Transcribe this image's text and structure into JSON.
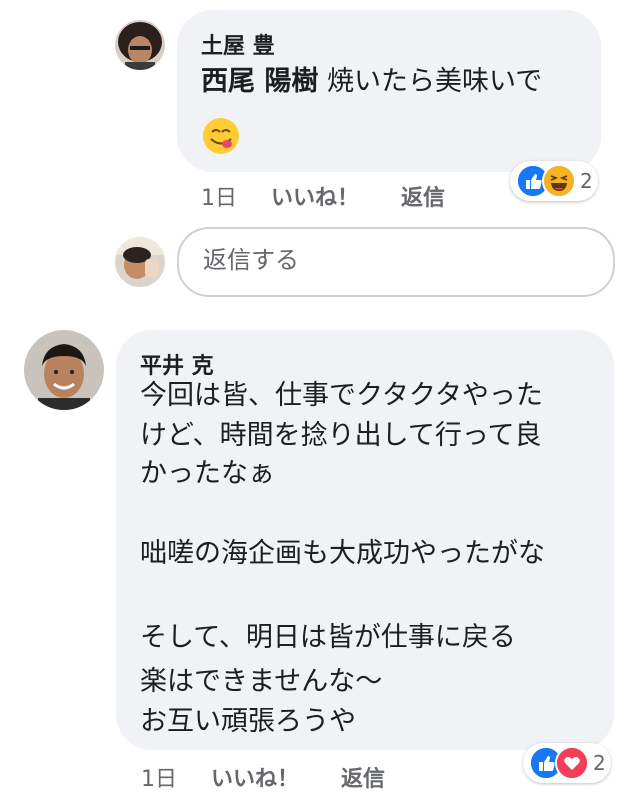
{
  "comments": [
    {
      "author": "土屋 豊",
      "mention": "西尾 陽樹",
      "text": "焼いたら美味いで",
      "emoji": "yum-face-emoji",
      "time": "1日",
      "like_label": "いいね！",
      "reply_label": "返信",
      "reactions": {
        "icons": [
          "like-reaction",
          "haha-reaction"
        ],
        "count": "2"
      }
    },
    {
      "author": "平井 克",
      "lines": [
        "今回は皆、仕事でクタクタやった",
        "けど、時間を捻り出して行って良",
        "かったなぁ",
        "",
        "咄嗟の海企画も大成功やったがな",
        "",
        "そして、明日は皆が仕事に戻る",
        "楽はできませんな〜",
        "お互い頑張ろうや"
      ],
      "time": "1日",
      "like_label": "いいね！",
      "reply_label": "返信",
      "reactions": {
        "icons": [
          "like-reaction",
          "love-reaction"
        ],
        "count": "2"
      }
    }
  ],
  "reply_box": {
    "placeholder": "返信する"
  },
  "colors": {
    "bubble": "#f0f2f5",
    "meta_text": "#65676b",
    "like_blue": "#1877f2",
    "love_red": "#f33e58",
    "haha_yellow": "#f7b125"
  }
}
